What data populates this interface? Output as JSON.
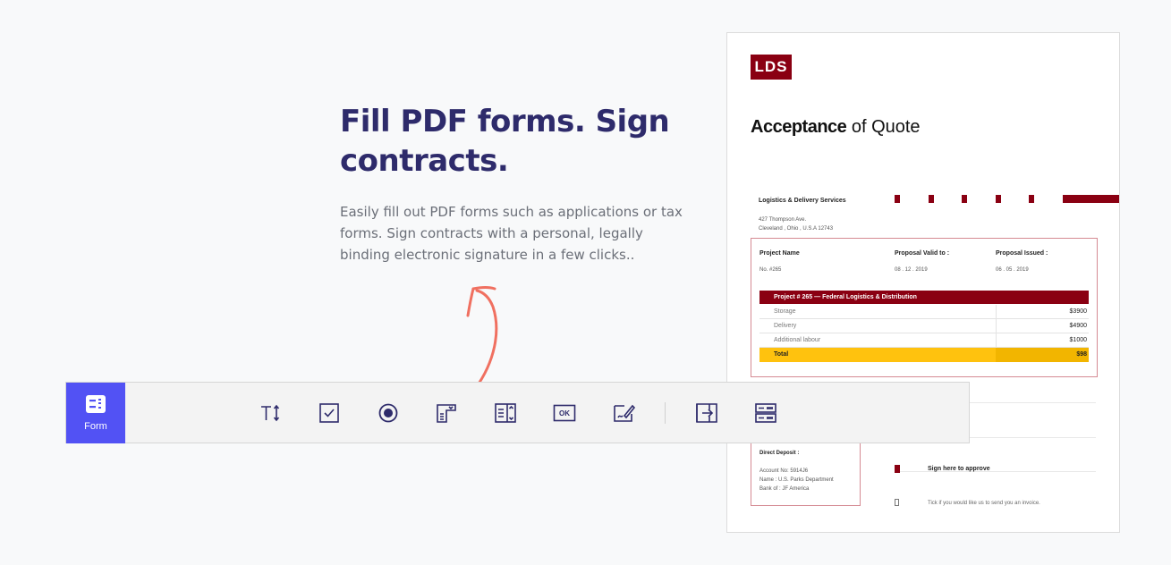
{
  "hero": {
    "title": "Fill PDF forms. Sign contracts.",
    "text": "Easily fill out PDF forms such as applications or tax forms. Sign contracts with a personal, legally binding electronic signature in a few clicks.."
  },
  "document": {
    "logo": "LDS",
    "title_bold": "Acceptance",
    "title_rest": " of Quote",
    "company": "Logistics & Delivery Services",
    "address_line1": "427 Thompson Ave.",
    "address_line2": "Cleveland , Ohio , U.S.A 12743",
    "project_name_label": "Project Name",
    "project_name_value": "No. #265",
    "valid_label": "Proposal Valid to :",
    "valid_value": "08 . 12 . 2019",
    "issued_label": "Proposal Issued :",
    "issued_value": "06 . 05 . 2019",
    "project_bar": "Project # 265 — Federal Logistics & Distribution",
    "rows": [
      {
        "item": "Storage",
        "amount": "$3900"
      },
      {
        "item": "Delivery",
        "amount": "$4900"
      },
      {
        "item": "Additional labour",
        "amount": "$1000"
      }
    ],
    "total_label": "Total",
    "total_value": "$98",
    "deposit_title": "Direct Deposit :",
    "deposit_line1": "Account No: 5914J6",
    "deposit_line2": "Name :  U.S. Parks Department",
    "deposit_line3": "Bank of : JF America",
    "sign_text": "Sign here to approve",
    "tick_text": "Tick if you would like us to send you an invoice."
  },
  "toolbar": {
    "form_label": "Form",
    "ok_label": "OK",
    "tools": [
      "text-field-icon",
      "checkbox-icon",
      "radio-button-icon",
      "dropdown-icon",
      "list-box-icon",
      "button-icon",
      "signature-icon",
      "import-icon",
      "form-fields-icon"
    ]
  },
  "colors": {
    "accent": "#5252f4",
    "heading": "#2e2b6b",
    "brand_red": "#8a0012",
    "total_yellow": "#ffc20e",
    "arrow": "#f07060"
  }
}
